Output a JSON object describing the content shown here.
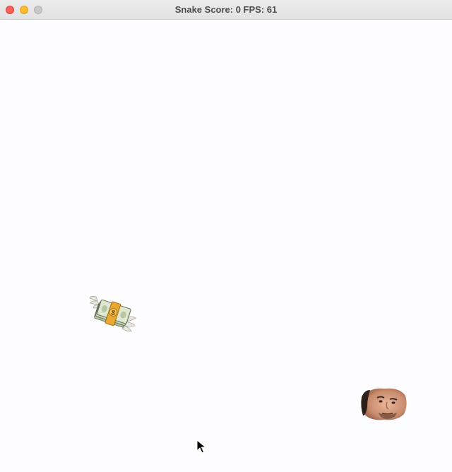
{
  "window": {
    "title": "Snake Score: 0 FPS: 61"
  },
  "game": {
    "score": 0,
    "fps": 61,
    "food": {
      "icon": "money-with-wings-icon"
    },
    "snake_head": {
      "icon": "face-icon"
    }
  },
  "colors": {
    "background": "#fdfcff",
    "close": "#fe5f57",
    "minimize": "#febc2e",
    "zoom": "#c8c8c8"
  }
}
